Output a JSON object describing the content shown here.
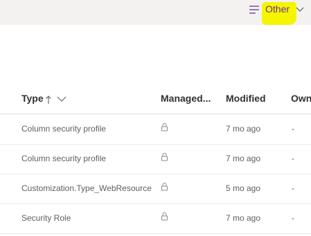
{
  "toolbar": {
    "view_filter_label": "Other",
    "view_filter_icon": "hamburger-lines-icon",
    "view_filter_chevron": "chevron-down-icon",
    "accent_color": "#6b2fa0",
    "highlight_color": "#f5f500"
  },
  "table": {
    "columns": [
      {
        "label": "Type",
        "sort": "ascending"
      },
      {
        "label": "Managed..."
      },
      {
        "label": "Modified"
      },
      {
        "label": "Own"
      }
    ],
    "rows": [
      {
        "type": "Column security profile",
        "managed_icon": "lock-icon",
        "modified": "7 mo ago",
        "owner": "-"
      },
      {
        "type": "Column security profile",
        "managed_icon": "lock-icon",
        "modified": "7 mo ago",
        "owner": "-"
      },
      {
        "type": "Customization.Type_WebResource",
        "managed_icon": "lock-icon",
        "modified": "5 mo ago",
        "owner": "-"
      },
      {
        "type": "Security Role",
        "managed_icon": "lock-icon",
        "modified": "7 mo ago",
        "owner": "-"
      }
    ]
  }
}
